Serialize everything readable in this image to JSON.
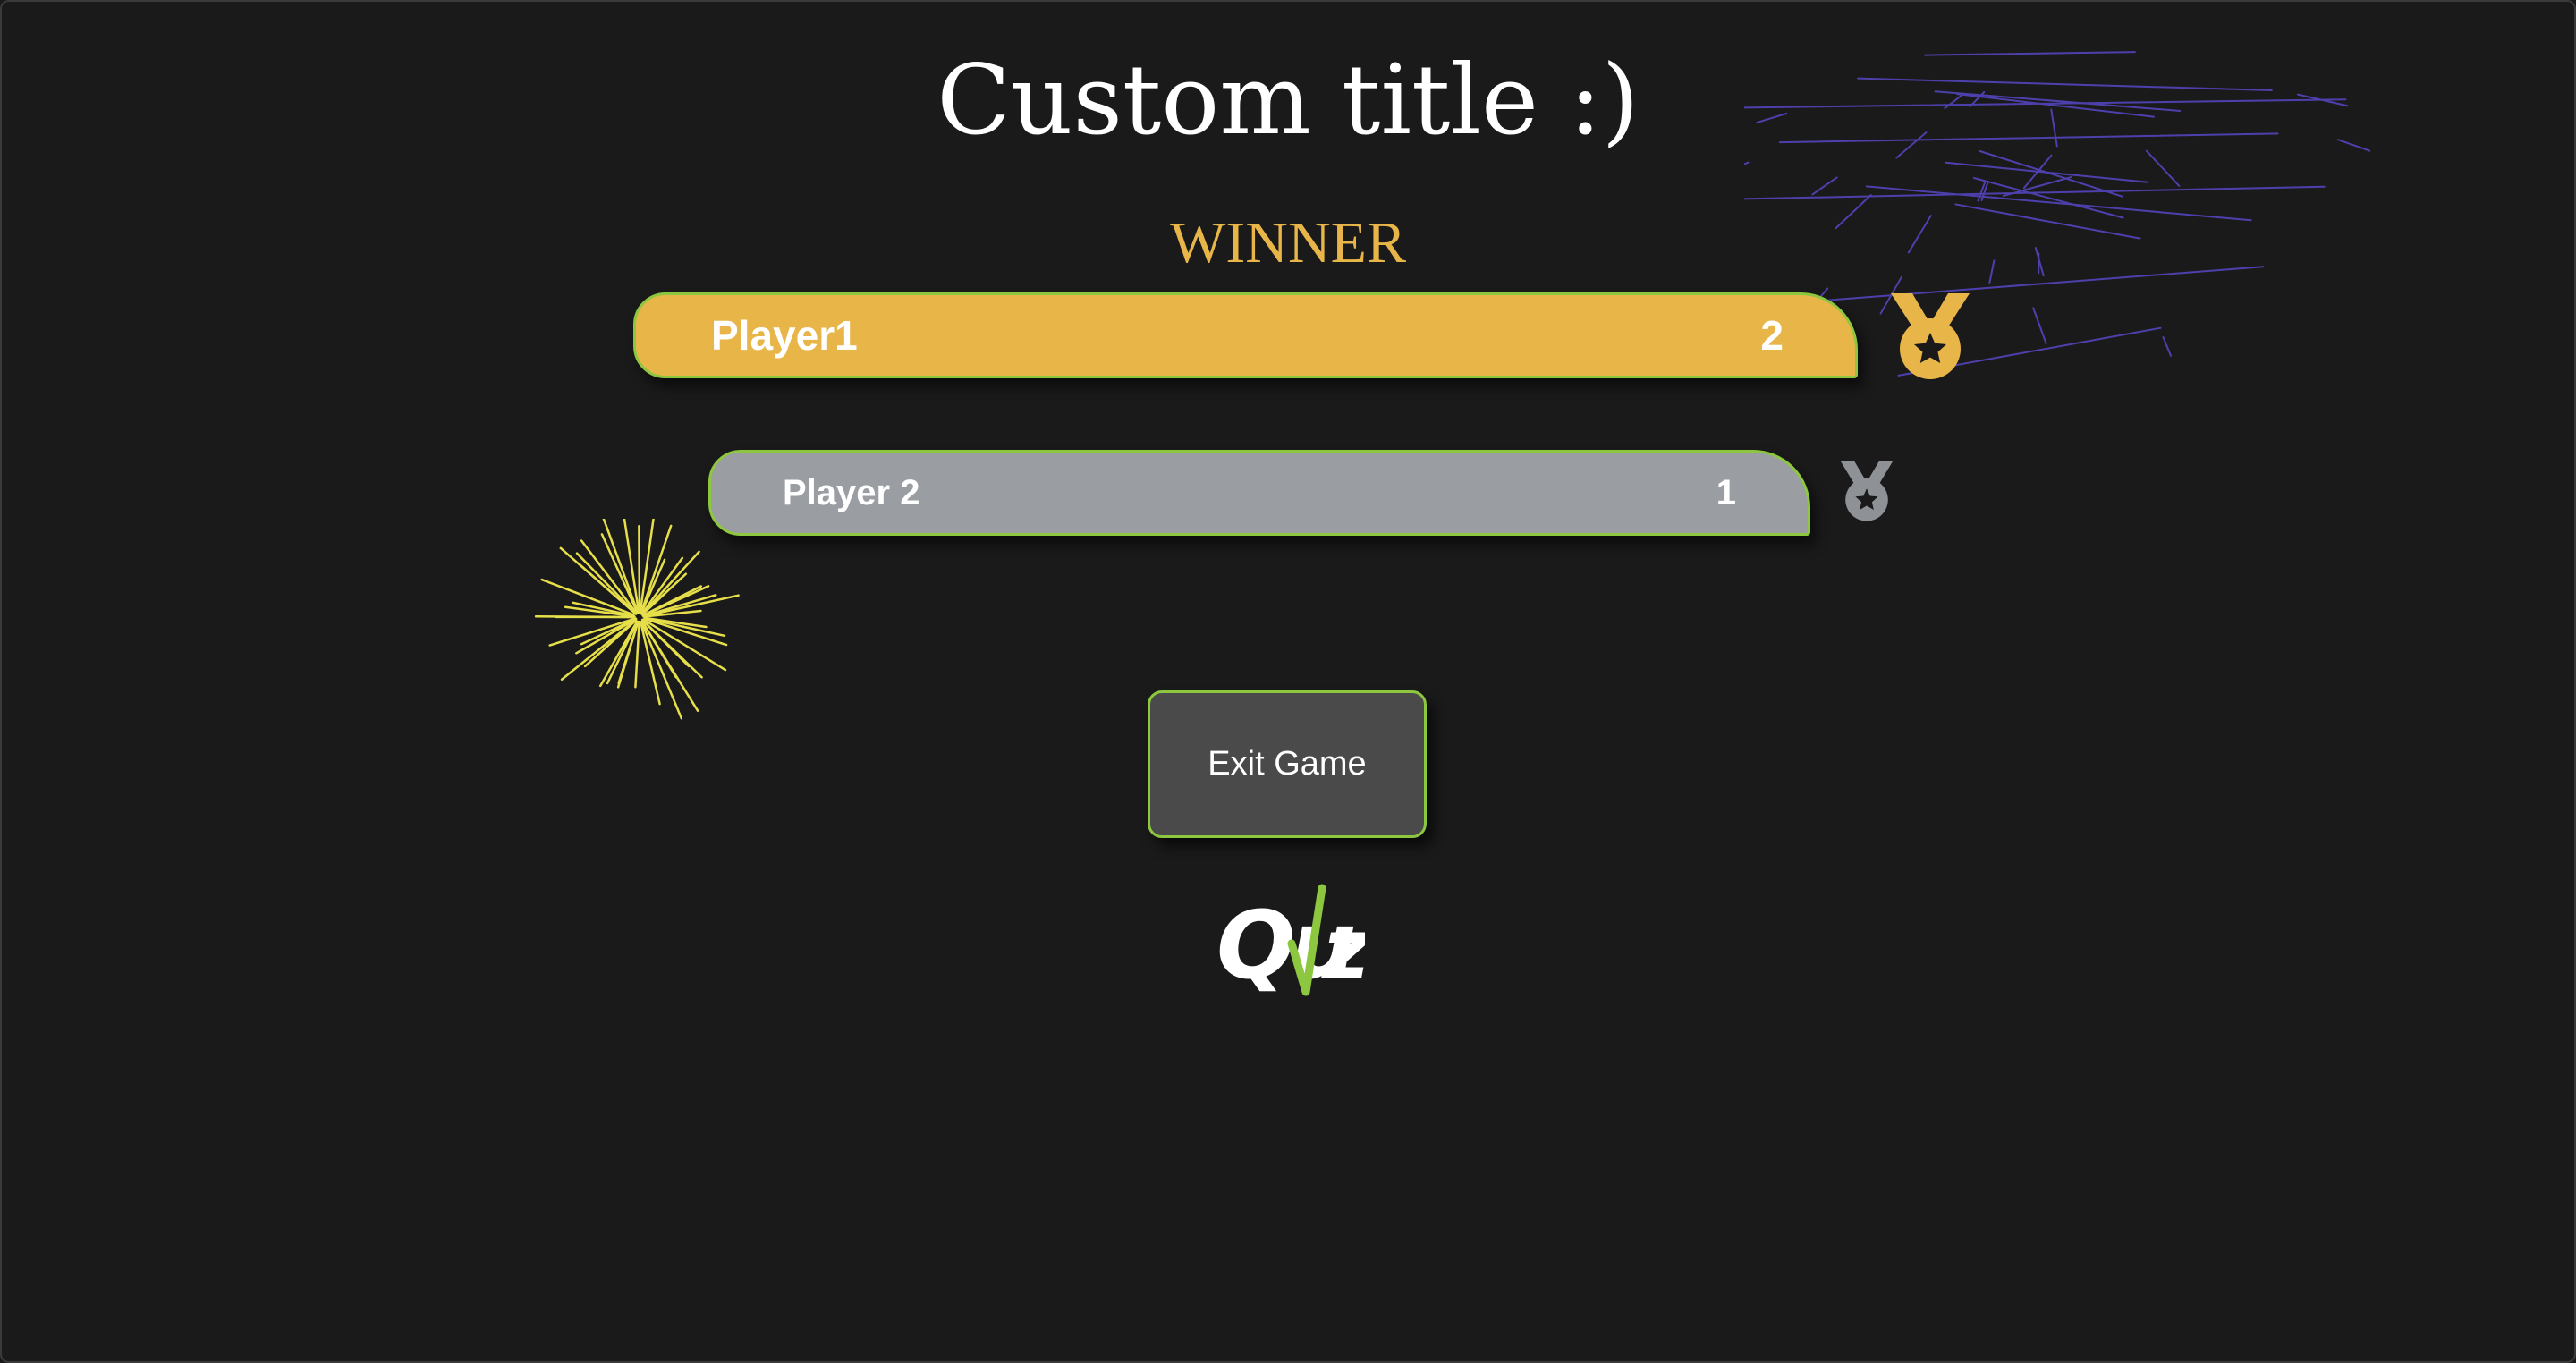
{
  "game": {
    "title": "Custom title :)",
    "winner_label": "WINNER"
  },
  "leaderboard": [
    {
      "rank": 1,
      "name": "Player1",
      "score": "2",
      "medal": "gold-medal-icon",
      "color": "#e8b548"
    },
    {
      "rank": 2,
      "name": "Player 2",
      "score": "1",
      "medal": "silver-medal-icon",
      "color": "#9a9ea3"
    }
  ],
  "actions": {
    "exit_label": "Exit Game"
  },
  "brand": {
    "logo_text": "Quiz",
    "logo_icon": "quiz-logo-icon",
    "accent": "#8dc63f"
  },
  "decorations": {
    "fireworks": [
      "yellow-firework",
      "purple-firework"
    ]
  }
}
